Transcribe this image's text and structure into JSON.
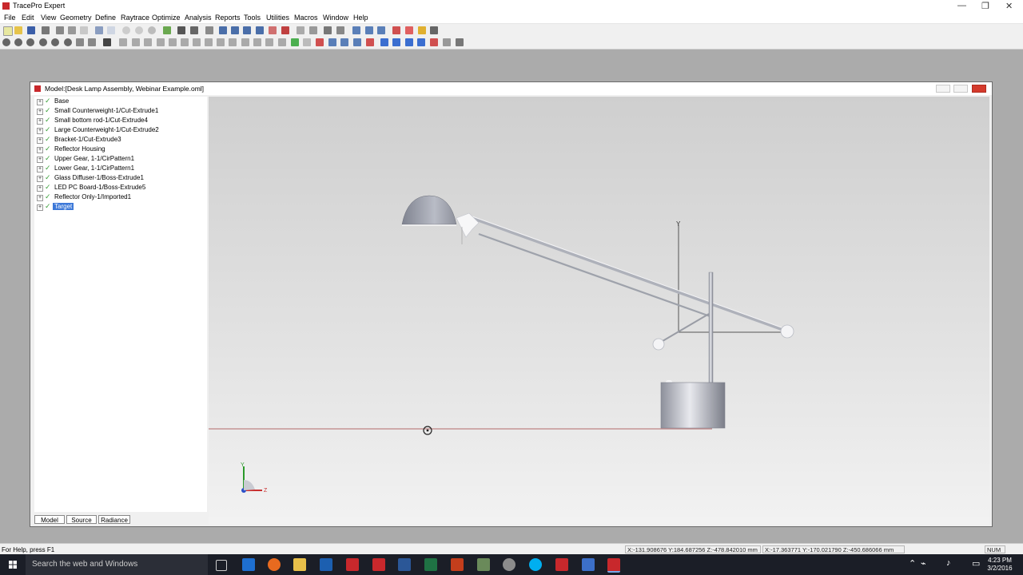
{
  "window": {
    "title": "TracePro Expert",
    "minimize_glyph": "—",
    "restore_glyph": "❐",
    "close_glyph": "✕"
  },
  "menu": [
    "File",
    "Edit",
    "View",
    "Geometry",
    "Define",
    "Raytrace",
    "Optimize",
    "Analysis",
    "Reports",
    "Tools",
    "Utilities",
    "Macros",
    "Window",
    "Help"
  ],
  "model_window": {
    "title": "Model:[Desk Lamp Assembly, Webinar Example.oml]"
  },
  "tree": {
    "items": [
      {
        "label": "Base",
        "selected": false
      },
      {
        "label": "Small Counterweight-1/Cut-Extrude1",
        "selected": false
      },
      {
        "label": "Small bottom rod-1/Cut-Extrude4",
        "selected": false
      },
      {
        "label": "Large Counterweight-1/Cut-Extrude2",
        "selected": false
      },
      {
        "label": "Bracket-1/Cut-Extrude3",
        "selected": false
      },
      {
        "label": "Reflector Housing",
        "selected": false
      },
      {
        "label": "Upper Gear, 1-1/CirPattern1",
        "selected": false
      },
      {
        "label": "Lower Gear, 1-1/CirPattern1",
        "selected": false
      },
      {
        "label": "Glass Diffuser-1/Boss-Extrude1",
        "selected": false
      },
      {
        "label": "LED PC Board-1/Boss-Extrude5",
        "selected": false
      },
      {
        "label": "Reflector Only-1/Imported1",
        "selected": false
      },
      {
        "label": "Target",
        "selected": true
      }
    ],
    "expander_glyph": "+",
    "check_glyph": "✓"
  },
  "tabs": [
    "Model",
    "Source",
    "Radiance"
  ],
  "viewport": {
    "axis_y_label": "Y",
    "triad_y_label": "Y",
    "triad_z_label": "Z",
    "background_top": "#cfcfcf",
    "background_bottom": "#f2f2f2",
    "lamp_color": "#9fa3ad",
    "rod_color": "#c9ccd3",
    "target_line_color": "#a04040"
  },
  "status": {
    "help_text": "For Help, press F1",
    "coord1": "X:-131.908676 Y:184.687256 Z:-478.842010 mm",
    "coord2": "X:-17.363771 Y:-170.021790 Z:-450.686066 mm",
    "num": "NUM"
  },
  "taskbar": {
    "search_placeholder": "Search the web and Windows",
    "time": "4:23 PM",
    "date": "3/2/2016",
    "tray_up_glyph": "⌃",
    "tray_net_glyph": "⌁",
    "tray_vol_glyph": "♪",
    "tray_msg_glyph": "▭"
  }
}
